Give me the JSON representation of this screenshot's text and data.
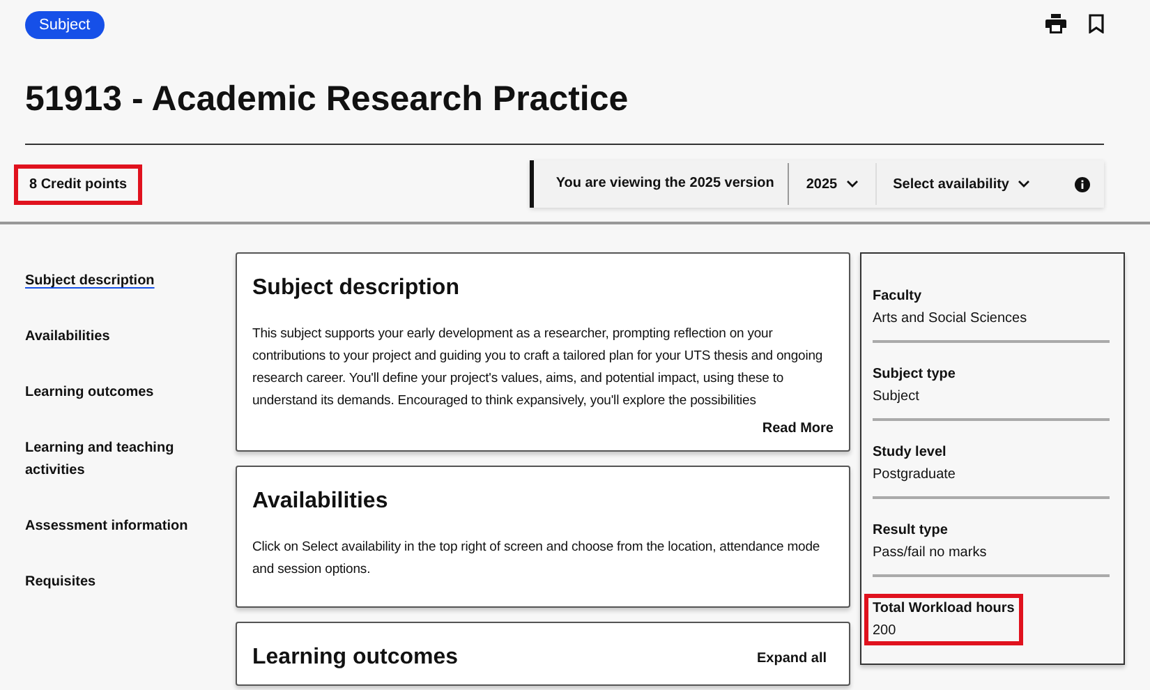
{
  "badge": "Subject",
  "title": "51913 - Academic Research Practice",
  "credit_points": {
    "text": "8 Credit points",
    "highlighted": true
  },
  "version_bar": {
    "text": "You are viewing the 2025 version",
    "year": "2025",
    "availability": "Select availability"
  },
  "sidebar": {
    "items": [
      {
        "label": "Subject description",
        "selected": true
      },
      {
        "label": "Availabilities",
        "selected": false
      },
      {
        "label": "Learning outcomes",
        "selected": false
      },
      {
        "label": "Learning and teaching activities",
        "selected": false
      },
      {
        "label": "Assessment information",
        "selected": false
      },
      {
        "label": "Requisites",
        "selected": false
      }
    ]
  },
  "sections": [
    {
      "kind": "description",
      "title": "Subject description",
      "body": "This subject supports your early development as a researcher, prompting reflection on your contributions to your project and guiding you to craft a tailored plan for your UTS thesis and ongoing research career. You'll define your project's values, aims, and potential impact, using these to understand its demands. Encouraged to think expansively, you'll explore the possibilities",
      "action": "Read More"
    },
    {
      "kind": "text",
      "title": "Availabilities",
      "body": "Click on Select availability in the top right of screen and choose from the location, attendance mode and session options."
    },
    {
      "kind": "expandable",
      "title": "Learning outcomes",
      "action": "Expand all"
    }
  ],
  "details": [
    {
      "label": "Faculty",
      "value": "Arts and Social Sciences",
      "highlighted": false
    },
    {
      "label": "Subject type",
      "value": "Subject",
      "highlighted": false
    },
    {
      "label": "Study level",
      "value": "Postgraduate",
      "highlighted": false
    },
    {
      "label": "Result type",
      "value": "Pass/fail no marks",
      "highlighted": false
    },
    {
      "label": "Total Workload hours",
      "value": "200",
      "highlighted": true
    }
  ]
}
